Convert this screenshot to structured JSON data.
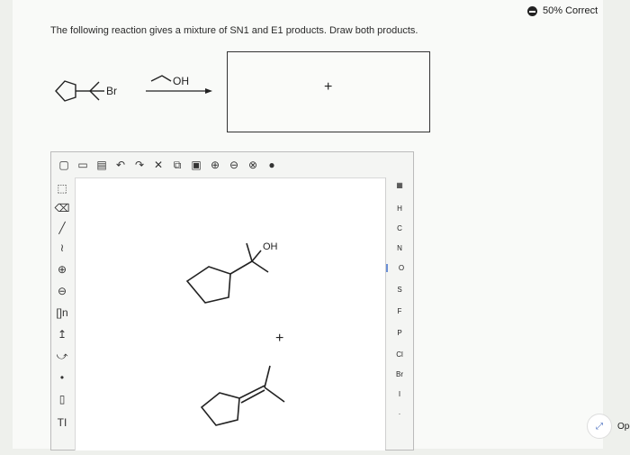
{
  "question": "The following reaction gives a mixture of SN1 and E1 products. Draw both products.",
  "score": {
    "label": "50% Correct"
  },
  "reaction": {
    "leaving_group": "Br",
    "reagent": "OH"
  },
  "answer_box": {
    "plus": "+"
  },
  "canvas": {
    "product_label": "OH",
    "plus": "+"
  },
  "toolbar": {
    "icons": [
      "new-icon",
      "open-icon",
      "save-icon",
      "undo-icon",
      "redo-icon",
      "cut-icon",
      "copy-icon",
      "paste-icon",
      "zoom-in-icon",
      "zoom-out-icon",
      "zoom-reset-icon",
      "info-icon"
    ]
  },
  "left_tools": {
    "text_tool": "TI",
    "bracket_tool": "[]n"
  },
  "periodic": {
    "elements": [
      "H",
      "C",
      "N",
      "O",
      "S",
      "F",
      "P",
      "Cl",
      "Br",
      "I",
      "·"
    ],
    "selected": "O"
  },
  "open_button": {
    "label": "Open"
  }
}
